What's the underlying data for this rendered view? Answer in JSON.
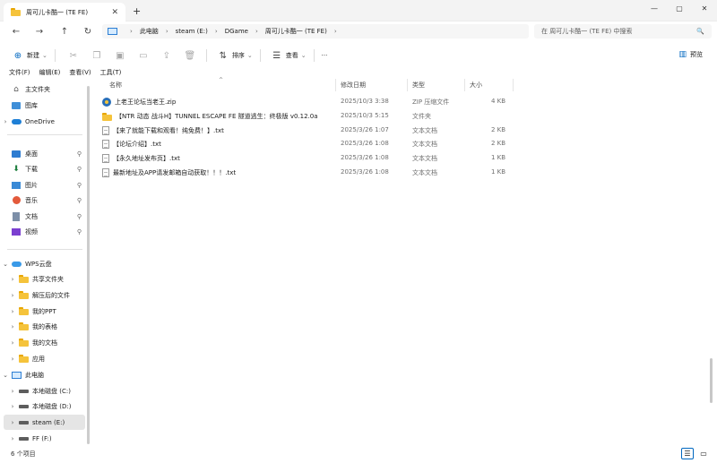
{
  "tab": {
    "title": "周可儿卡酷一 (TE FE)",
    "close": "✕",
    "new_tab": "+"
  },
  "window": {
    "minimize": "—",
    "maximize": "▢",
    "close": "✕"
  },
  "nav": {
    "back": "←",
    "forward": "→",
    "up": "↑",
    "refresh": "↻"
  },
  "breadcrumb": [
    "此电脑",
    "steam (E:)",
    "DGame",
    "周可儿卡酷一 (TE FE)"
  ],
  "search": {
    "placeholder": "在 周可儿卡酷一 (TE FE) 中搜索",
    "icon": "🔍"
  },
  "toolbar": {
    "new_label": "新建",
    "sort_label": "排序",
    "view_label": "查看",
    "more_label": "···",
    "preview_label": "预览"
  },
  "menu": [
    "文件(F)",
    "编辑(E)",
    "查看(V)",
    "工具(T)"
  ],
  "sidebar": {
    "quick": [
      {
        "label": "主文件夹",
        "icon": "home-icon",
        "chevron": ""
      },
      {
        "label": "图库",
        "icon": "gallery-icon",
        "chevron": ""
      },
      {
        "label": "OneDrive",
        "icon": "cloud-icon",
        "chevron": "›"
      }
    ],
    "pinned": [
      {
        "label": "桌面",
        "icon": "desktop-icon",
        "pin": "📌"
      },
      {
        "label": "下载",
        "icon": "download-icon",
        "pin": "📌"
      },
      {
        "label": "图片",
        "icon": "pictures-icon",
        "pin": "📌"
      },
      {
        "label": "音乐",
        "icon": "music-icon",
        "pin": "📌"
      },
      {
        "label": "文档",
        "icon": "docs-icon",
        "pin": "📌"
      },
      {
        "label": "视频",
        "icon": "video-icon",
        "pin": "📌"
      }
    ],
    "wps": {
      "label": "WPS云盘",
      "children": [
        "共享文件夹",
        "解压后的文件",
        "我的PPT",
        "我的表格",
        "我的文档",
        "应用"
      ]
    },
    "pc": {
      "label": "此电脑",
      "drives": [
        "本地磁盘 (C:)",
        "本地磁盘 (D:)",
        "steam (E:)",
        "FF (F:)"
      ]
    }
  },
  "columns": {
    "name": "名称",
    "date": "修改日期",
    "type": "类型",
    "size": "大小",
    "sort_indicator": "^"
  },
  "files": [
    {
      "name": "上老王论坛当老王.zip",
      "date": "2025/10/3 3:38",
      "type": "ZIP 压缩文件",
      "size": "4 KB",
      "icon": "zip-icon"
    },
    {
      "name": "【NTR 动态 战斗H】TUNNEL ESCAPE FE 隧道逃生：终极版  v0.12.0a",
      "date": "2025/10/3 5:15",
      "type": "文件夹",
      "size": "",
      "icon": "folder-icon"
    },
    {
      "name": "【来了就能下载和观看！纯免费！】.txt",
      "date": "2025/3/26 1:07",
      "type": "文本文档",
      "size": "2 KB",
      "icon": "txt-icon"
    },
    {
      "name": "【论坛介绍】.txt",
      "date": "2025/3/26 1:08",
      "type": "文本文档",
      "size": "2 KB",
      "icon": "txt-icon"
    },
    {
      "name": "【永久地址发布页】.txt",
      "date": "2025/3/26 1:08",
      "type": "文本文档",
      "size": "1 KB",
      "icon": "txt-icon"
    },
    {
      "name": "最新地址及APP请发邮箱自动获取！！！.txt",
      "date": "2025/3/26 1:08",
      "type": "文本文档",
      "size": "1 KB",
      "icon": "txt-icon"
    }
  ],
  "status": {
    "count": "6 个项目"
  }
}
